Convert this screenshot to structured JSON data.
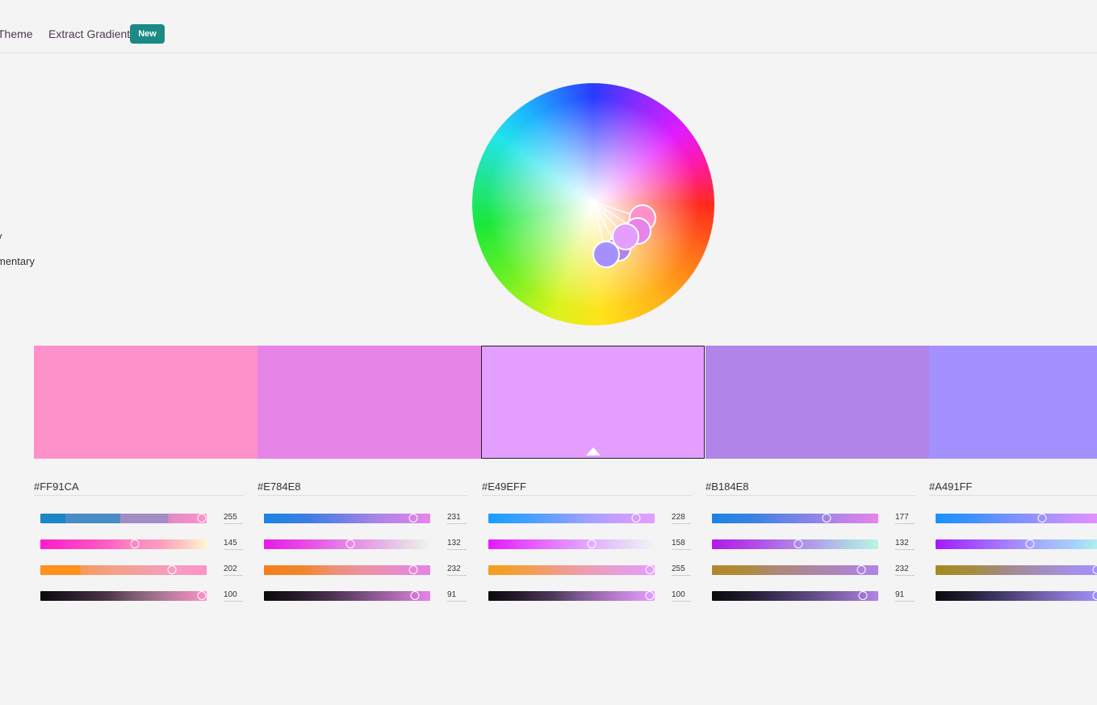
{
  "nav": {
    "theme_label": "Theme",
    "extract_gradient_label": "Extract Gradient",
    "new_badge": "New"
  },
  "side": {
    "item1": "y",
    "item2": "mentary"
  },
  "wheel": {
    "handle_colors": [
      "#FF91CA",
      "#E784E8",
      "#E49EFF",
      "#B184E8",
      "#A491FF"
    ]
  },
  "palette": [
    {
      "hex": "#FF91CA",
      "color": "#FF91CA",
      "selected": false,
      "channels": [
        {
          "name": "R",
          "value": "255",
          "frac": 1.0,
          "gradient": "linear-gradient(90deg,#1b86c8 0%,#1b86c8 15%,#4a8dc4 15%,#4a8dc4 48%,#a38cc4 48%,#a38cc4 77%,#e08ac8 77%,#ff91ca 100%)"
        },
        {
          "name": "G",
          "value": "145",
          "frac": 0.57,
          "gradient": "linear-gradient(90deg,#ff1ad0 0%,#ff3cc5 20%,#ff5fc2 40%,#ff84c0 55%,#ff9cbf 72%,#ffc9c3 87%,#fff7cc 100%)"
        },
        {
          "name": "B",
          "value": "202",
          "frac": 0.79,
          "gradient": "linear-gradient(90deg,#ff901a 0%,#ff901a 24%,#f59a5a 24%,#f5a08a 45%,#f2a0a4 62%,#f59ec0 80%,#ff91ca 100%)"
        },
        {
          "name": "L",
          "value": "100",
          "frac": 1.0,
          "gradient": "linear-gradient(90deg,#0a0a0d 0%,#2a1d2c 20%,#4b3548 40%,#7a5a70 55%,#b07a98 75%,#ff91ca 100%)"
        }
      ]
    },
    {
      "hex": "#E784E8",
      "color": "#E784E8",
      "selected": false,
      "channels": [
        {
          "name": "R",
          "value": "231",
          "frac": 0.9,
          "gradient": "linear-gradient(90deg,#1a84e2 0%,#3a7ee4 25%,#6b80e6 45%,#a284e6 65%,#cc84e8 85%,#e784e8 100%)"
        },
        {
          "name": "G",
          "value": "132",
          "frac": 0.52,
          "gradient": "linear-gradient(90deg,#e71ae8 0%,#e84ae8 25%,#e884e8 50%,#e4b0e6 70%,#e8dce8 88%,#f4f4ea 100%)"
        },
        {
          "name": "B",
          "value": "232",
          "frac": 0.9,
          "gradient": "linear-gradient(90deg,#f47f1a 0%,#f2862e 25%,#ef8f70 40%,#ea92a2 60%,#e78cc8 80%,#e784e8 100%)"
        },
        {
          "name": "L",
          "value": "91",
          "frac": 0.91,
          "gradient": "linear-gradient(90deg,#0a0a0d 0%,#251a2a 20%,#4a3050 40%,#7a5080 60%,#b06ab2 80%,#e784e8 100%)"
        }
      ]
    },
    {
      "hex": "#E49EFF",
      "color": "#E49EFF",
      "selected": true,
      "channels": [
        {
          "name": "R",
          "value": "228",
          "frac": 0.89,
          "gradient": "linear-gradient(90deg,#1a9eff 0%,#3aa0ff 20%,#6aa0ff 40%,#a2a0ff 60%,#cc9eff 80%,#e49eff 100%)"
        },
        {
          "name": "G",
          "value": "158",
          "frac": 0.62,
          "gradient": "linear-gradient(90deg,#e41aff 0%,#e64aff 20%,#e47cff 40%,#e2aaff 60%,#e6d2f8 80%,#f4f4f4 100%)"
        },
        {
          "name": "B",
          "value": "255",
          "frac": 1.0,
          "gradient": "linear-gradient(90deg,#f49e1a 0%,#f49e40 20%,#f19c80 40%,#ec9eb4 60%,#e69edc 80%,#e49eff 100%)"
        },
        {
          "name": "L",
          "value": "100",
          "frac": 1.0,
          "gradient": "linear-gradient(90deg,#0a0a0d 0%,#2a1e30 20%,#503a5e 40%,#7e5a92 55%,#b47ac8 75%,#e49eff 100%)"
        }
      ]
    },
    {
      "hex": "#B184E8",
      "color": "#B184E8",
      "selected": false,
      "channels": [
        {
          "name": "R",
          "value": "177",
          "frac": 0.69,
          "gradient": "linear-gradient(90deg,#1a84e2 0%,#3a82e4 25%,#6a84e6 45%,#9684e8 65%,#c084e8 80%,#e784e8 100%)"
        },
        {
          "name": "G",
          "value": "132",
          "frac": 0.52,
          "gradient": "linear-gradient(90deg,#b11ae8 0%,#b14ae8 25%,#b184e8 50%,#b1a8e8 65%,#b2cce6 80%,#b8f6e2 100%)"
        },
        {
          "name": "B",
          "value": "232",
          "frac": 0.9,
          "gradient": "linear-gradient(90deg,#b2862a 0%,#b08a40 22%,#ad8878 40%,#ac86a0 60%,#ae84c8 80%,#b184e8 100%)"
        },
        {
          "name": "L",
          "value": "91",
          "frac": 0.91,
          "gradient": "linear-gradient(90deg,#0a0a0d 0%,#201a2c 20%,#3e3058 40%,#604a84 60%,#8a66b4 80%,#b184e8 100%)"
        }
      ]
    },
    {
      "hex": "#A491FF",
      "color": "#A491FF",
      "selected": false,
      "channels": [
        {
          "name": "R",
          "value": "",
          "frac": 0.64,
          "gradient": "linear-gradient(90deg,#1a91ff 0%,#3a91ff 20%,#6a92ff 40%,#9491ff 60%,#c491ff 80%,#e491ff 100%)"
        },
        {
          "name": "G",
          "value": "",
          "frac": 0.57,
          "gradient": "linear-gradient(90deg,#a41aff 0%,#a44aff 20%,#a484ff 45%,#a4b2ff 65%,#a4d4f8 85%,#b0f6f0 100%)"
        },
        {
          "name": "B",
          "value": "",
          "frac": 1.0,
          "gradient": "linear-gradient(90deg,#a48a20 0%,#a48c40 22%,#a48a80 40%,#a48cb4 60%,#a48fe0 80%,#a491ff 100%)"
        },
        {
          "name": "L",
          "value": "",
          "frac": 1.0,
          "gradient": "linear-gradient(90deg,#0a0a0d 0%,#221e36 20%,#443a6a 40%,#6a5aa0 60%,#8a78d0 80%,#a491ff 100%)"
        }
      ]
    }
  ]
}
